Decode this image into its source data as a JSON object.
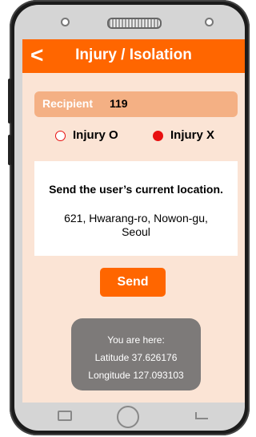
{
  "header": {
    "back_label": "<",
    "title": "Injury / Isolation"
  },
  "recipient": {
    "label": "Recipient",
    "value": "119"
  },
  "injury_options": [
    {
      "label": "Injury O",
      "selected": false
    },
    {
      "label": "Injury X",
      "selected": true
    }
  ],
  "location": {
    "heading": "Send the user’s current location.",
    "address_line1": "621, Hwarang-ro, Nowon-gu,",
    "address_line2": "Seoul"
  },
  "send_button": {
    "label": "Send"
  },
  "toast": {
    "line1": "You are here:",
    "line2": "Latitude 37.626176",
    "line3": "Longitude 127.093103"
  },
  "colors": {
    "accent": "#ff6600",
    "recipient_bar": "#f4b084",
    "screen_background": "#fbe4d5",
    "radio": "#e81010",
    "toast_background": "#7d7a79"
  },
  "icons": {
    "back": "chevron-left-icon",
    "nav_recent": "recent-apps-icon",
    "nav_home": "home-icon",
    "nav_back": "back-arrow-icon"
  }
}
